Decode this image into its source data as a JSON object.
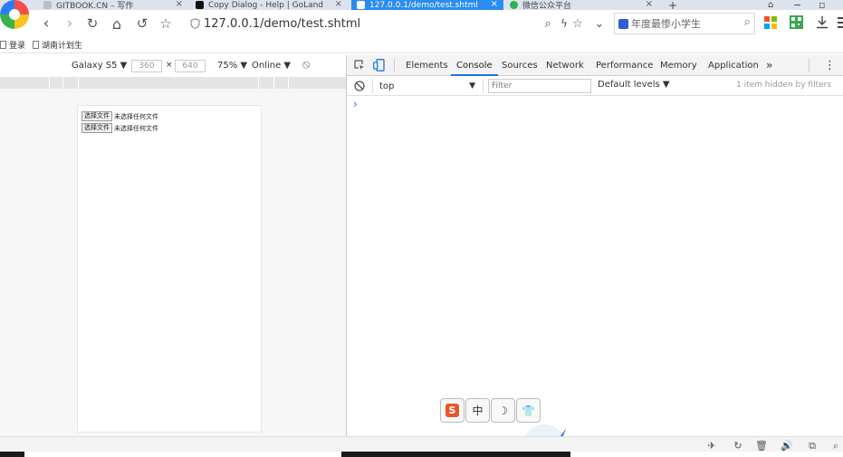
{
  "tabs": [
    {
      "title": "GITBOOK.CN – 写作",
      "fav_color": "#9aa3b0"
    },
    {
      "title": "Copy Dialog - Help | GoLand",
      "fav_color": "#111111"
    },
    {
      "title": "127.0.0.1/demo/test.shtml",
      "fav_color": "#ffffff"
    },
    {
      "title": "微信公众平台",
      "fav_color": "#2bb24c"
    }
  ],
  "tab_close": "×",
  "new_tab": "+",
  "window": {
    "minimize": "−",
    "restore": "▫"
  },
  "nav": {
    "back": "‹",
    "forward": "›",
    "reload": "↻",
    "home": "⌂",
    "undo": "↺",
    "star": "☆"
  },
  "address": {
    "url": "127.0.0.1/demo/test.shtml"
  },
  "address_actions": {
    "zoom": "⌕",
    "bolt": "ϟ",
    "star": "☆",
    "dropdown": "⌄"
  },
  "search": {
    "text": "年度最惨小学生",
    "icon": "⌕"
  },
  "bookmarks": [
    {
      "label": "登录"
    },
    {
      "label": "湖南计划生"
    }
  ],
  "device_toolbar": {
    "device": "Galaxy S5 ▼",
    "width": "360",
    "times": "×",
    "height": "640",
    "zoom": "75% ▼",
    "network": "Online ▼",
    "rotate": "⦸"
  },
  "page": {
    "file_inputs": [
      {
        "button": "选择文件",
        "status": "未选择任何文件"
      },
      {
        "button": "选择文件",
        "status": "未选择任何文件"
      }
    ]
  },
  "devtools": {
    "tabs": [
      {
        "label": "Elements"
      },
      {
        "label": "Console"
      },
      {
        "label": "Sources"
      },
      {
        "label": "Network"
      },
      {
        "label": "Performance"
      },
      {
        "label": "Memory"
      },
      {
        "label": "Application"
      }
    ],
    "more": "»",
    "kebab": "⋮",
    "console": {
      "clear": "⃠",
      "context": "top",
      "context_arrow": "▼",
      "filter_placeholder": "Filter",
      "levels": "Default levels ▼",
      "hidden": "1 item hidden by filters",
      "prompt": "›"
    }
  },
  "ime": {
    "s": "S",
    "zh": "中",
    "moon": "☽",
    "shirt": "👕"
  },
  "status_icons": [
    "✈",
    "↻",
    "🗑",
    "🔊",
    "⧉",
    "⌕"
  ]
}
